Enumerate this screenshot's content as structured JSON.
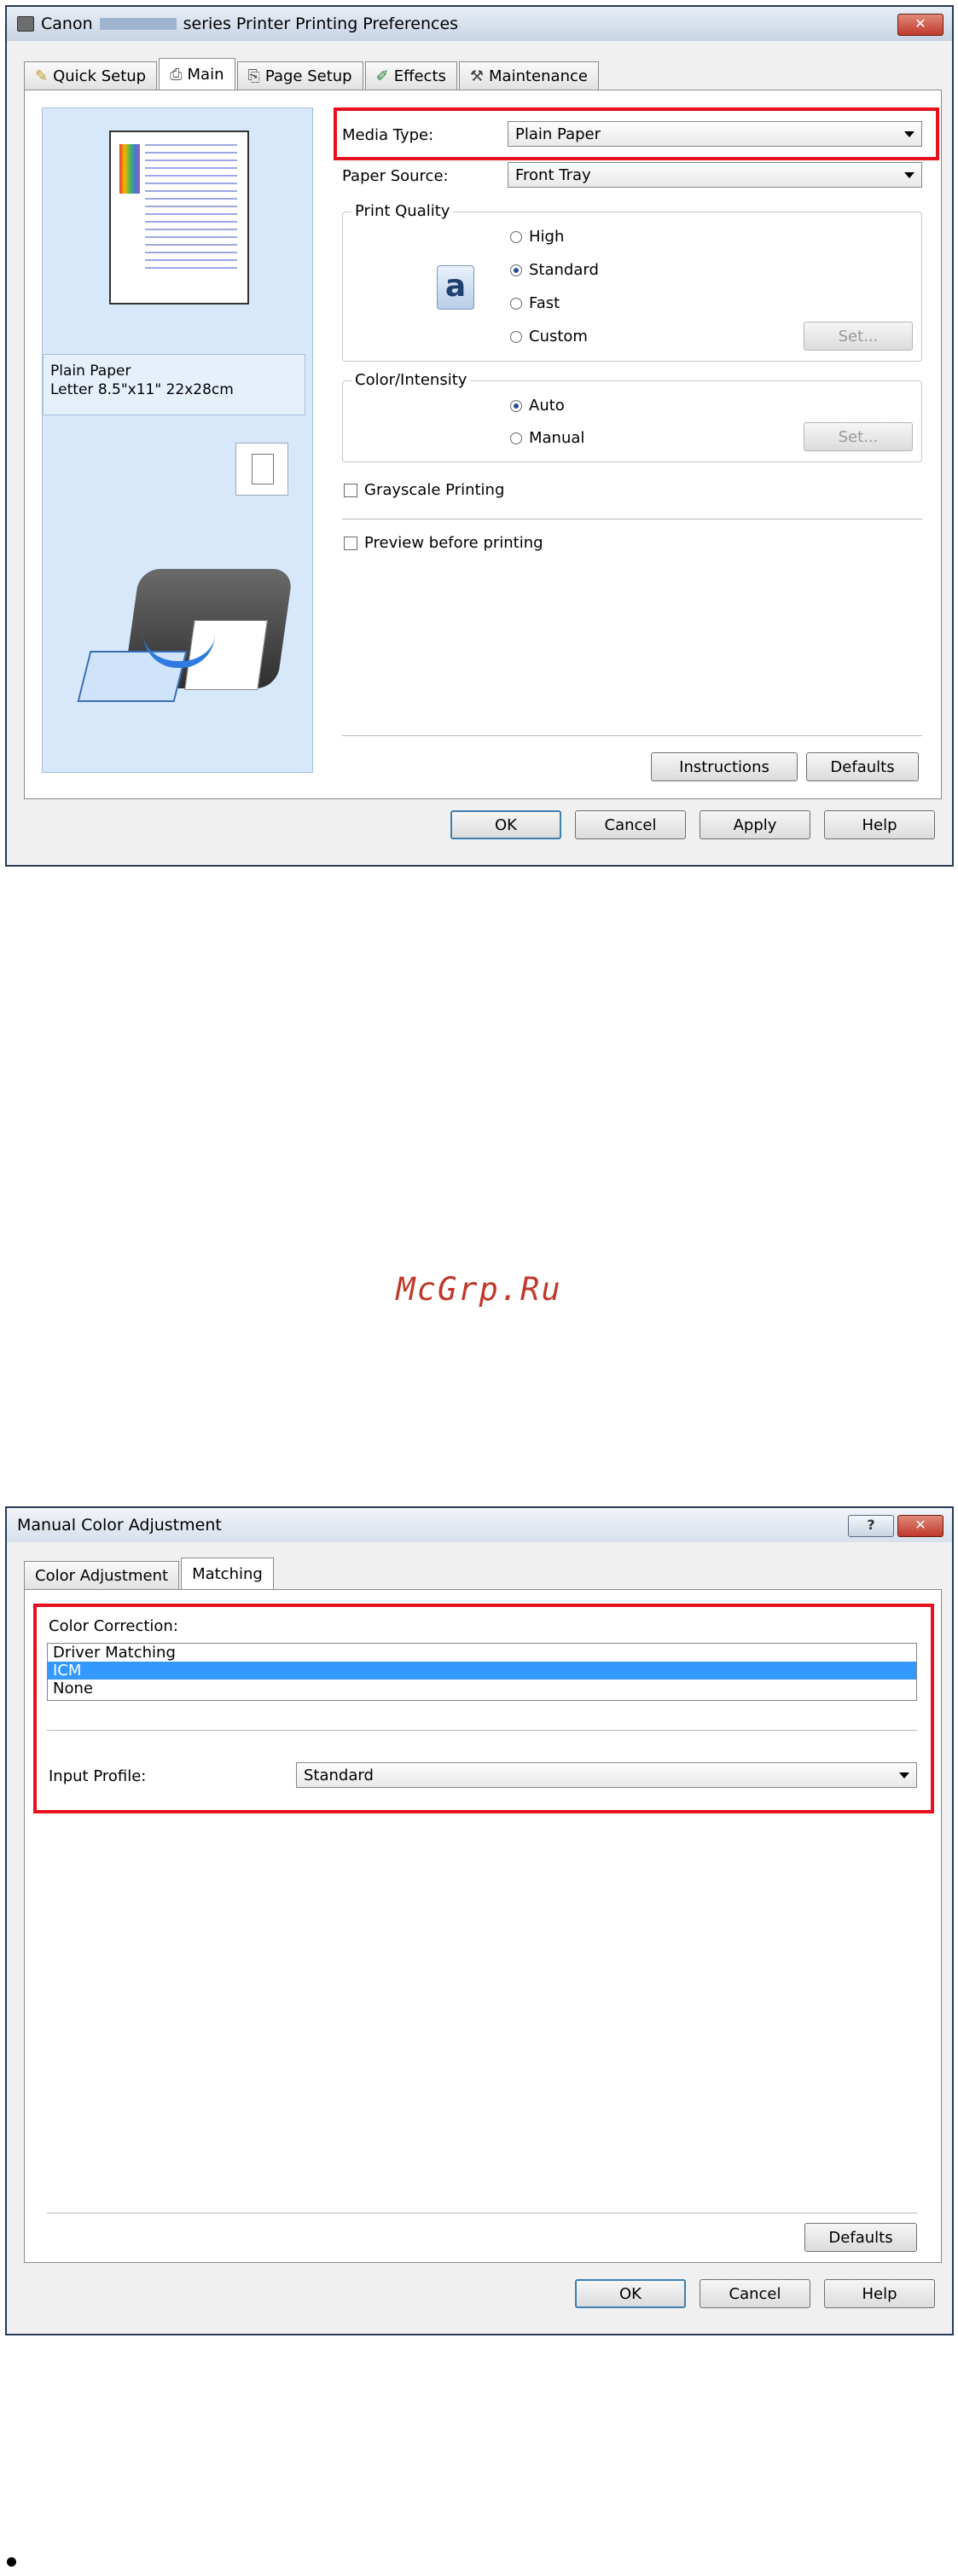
{
  "dialog1": {
    "title_prefix": "Canon",
    "title_suffix": "series Printer Printing Preferences",
    "close_label": "✕",
    "tabs": [
      {
        "label": "Quick Setup"
      },
      {
        "label": "Main"
      },
      {
        "label": "Page Setup"
      },
      {
        "label": "Effects"
      },
      {
        "label": "Maintenance"
      }
    ],
    "preview_info_line1": "Plain Paper",
    "preview_info_line2": "Letter 8.5\"x11\" 22x28cm",
    "media_type_label": "Media Type:",
    "media_type_value": "Plain Paper",
    "paper_source_label": "Paper Source:",
    "paper_source_value": "Front Tray",
    "print_quality_title": "Print Quality",
    "print_quality_options": [
      "High",
      "Standard",
      "Fast",
      "Custom"
    ],
    "print_quality_selected": "Standard",
    "set_label": "Set...",
    "color_intensity_title": "Color/Intensity",
    "color_options": [
      "Auto",
      "Manual"
    ],
    "color_selected": "Auto",
    "set2_label": "Set...",
    "grayscale_label": "Grayscale Printing",
    "preview_label": "Preview before printing",
    "instructions_label": "Instructions",
    "defaults_label": "Defaults",
    "ok_label": "OK",
    "cancel_label": "Cancel",
    "apply_label": "Apply",
    "help_label": "Help",
    "quality_glyph": "a"
  },
  "watermark": "McGrp.Ru",
  "dialog2": {
    "title": "Manual Color Adjustment",
    "help_glyph": "?",
    "close_label": "✕",
    "tabs": [
      {
        "label": "Color Adjustment"
      },
      {
        "label": "Matching"
      }
    ],
    "color_correction_label": "Color Correction:",
    "color_correction_items": [
      "Driver Matching",
      "ICM",
      "None"
    ],
    "color_correction_selected": "ICM",
    "input_profile_label": "Input Profile:",
    "input_profile_value": "Standard",
    "defaults_label": "Defaults",
    "ok_label": "OK",
    "cancel_label": "Cancel",
    "help_label": "Help"
  },
  "colors": {
    "highlight_red": "#e8101c",
    "selection_blue": "#3399ff",
    "preview_blue": "#d6e8fa",
    "watermark_red": "#c0392b"
  }
}
